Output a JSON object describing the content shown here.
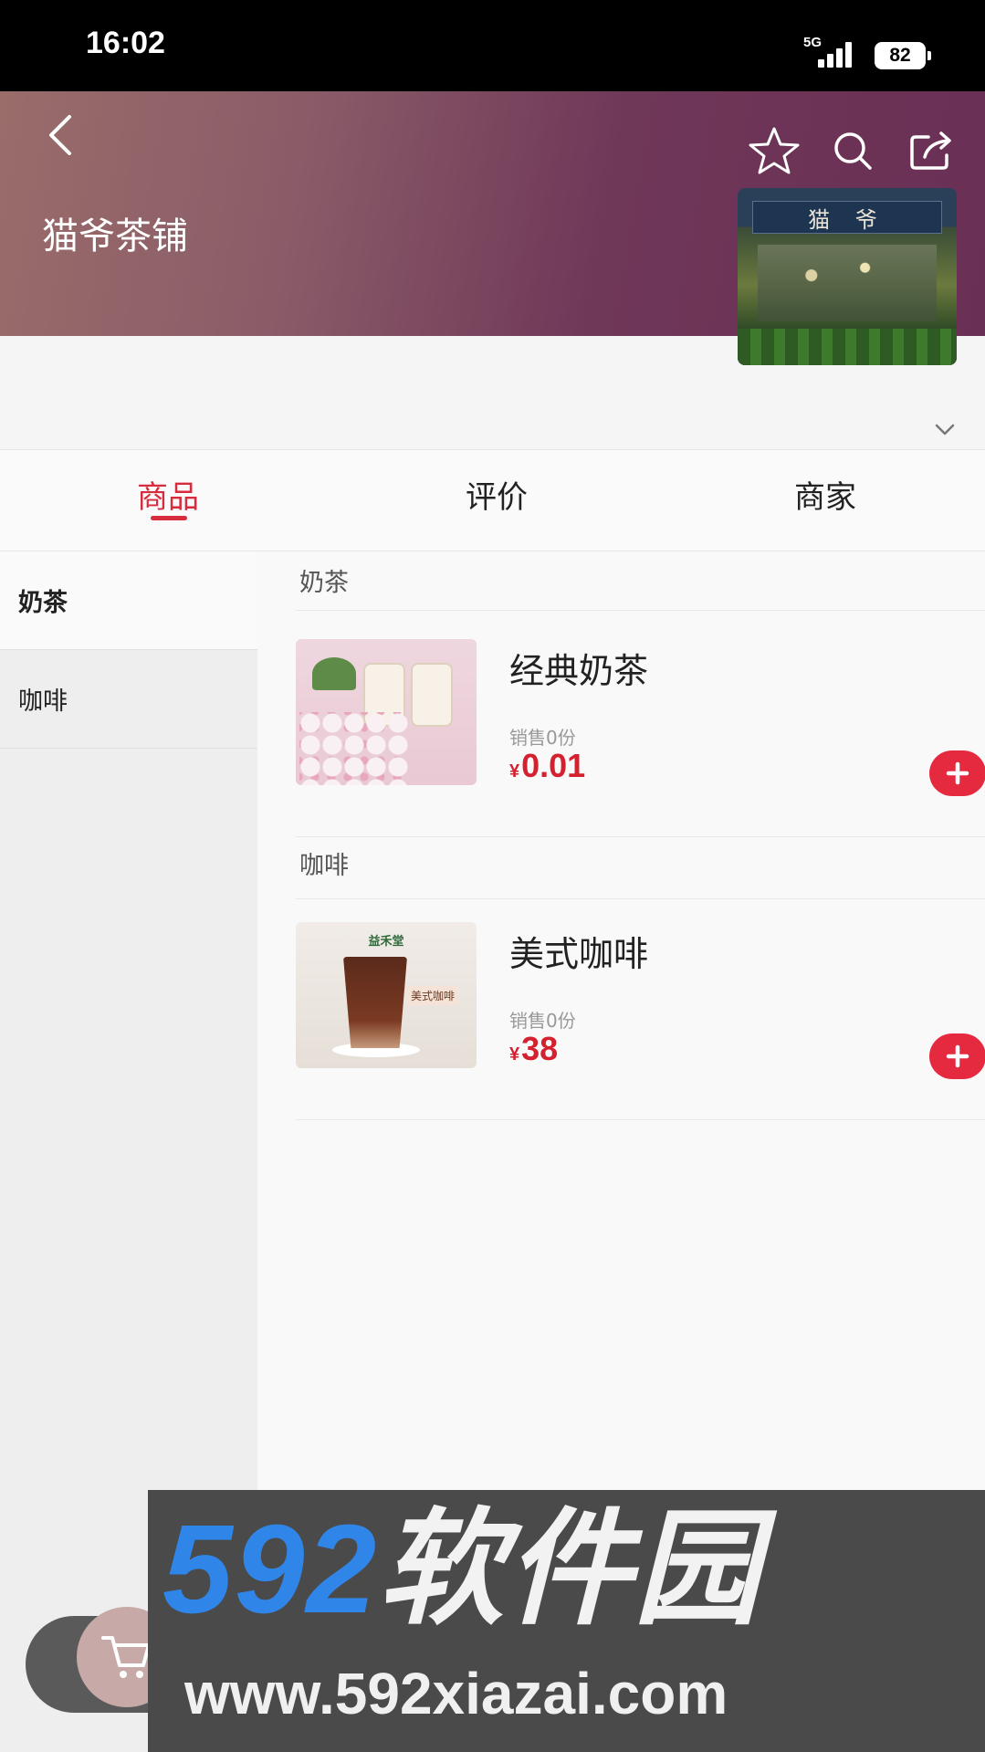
{
  "status_bar": {
    "time": "16:02",
    "network": "5G",
    "battery": "82"
  },
  "store": {
    "name": "猫爷茶铺",
    "sign_text": "猫 爷"
  },
  "tabs": [
    {
      "label": "商品",
      "active": true
    },
    {
      "label": "评价",
      "active": false
    },
    {
      "label": "商家",
      "active": false
    }
  ],
  "sidebar": {
    "items": [
      {
        "label": "奶茶"
      },
      {
        "label": "咖啡"
      }
    ]
  },
  "sections": [
    {
      "title": "奶茶",
      "products": [
        {
          "name": "经典奶茶",
          "sold": "销售0份",
          "currency": "¥",
          "price": "0.01"
        }
      ]
    },
    {
      "title": "咖啡",
      "products": [
        {
          "name": "美式咖啡",
          "sold": "销售0份",
          "currency": "¥",
          "price": "38"
        }
      ]
    }
  ],
  "thumb_text": {
    "coffee_brand": "益禾堂",
    "coffee_tag": "美式咖啡"
  },
  "watermark": {
    "logo_numbers": "592",
    "logo_text": "软件园",
    "url": "www.592xiazai.com"
  },
  "colors": {
    "accent": "#d72c3e",
    "price": "#d42130",
    "add_button": "#e52a40",
    "header_start": "#9a6c6a",
    "header_end": "#6a2f55"
  },
  "icons": [
    "back-icon",
    "star-icon",
    "search-icon",
    "share-icon",
    "chevron-down-icon",
    "plus-icon",
    "cart-icon"
  ]
}
